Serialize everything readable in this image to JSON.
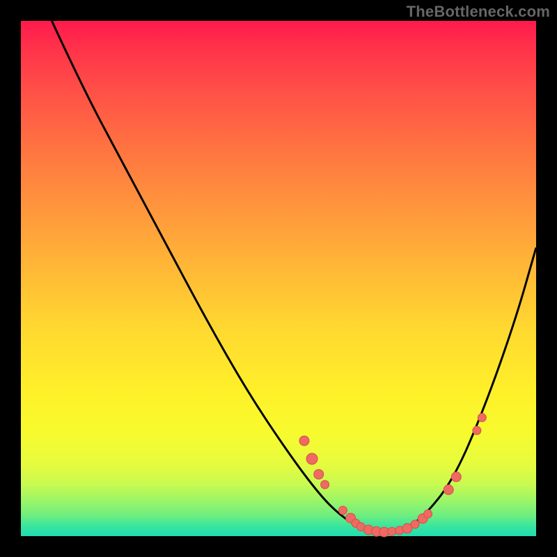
{
  "watermark": "TheBottleneck.com",
  "colors": {
    "frame": "#000000",
    "curve": "#000000",
    "dot_fill": "#ee6a62",
    "dot_stroke": "#d84f48"
  },
  "chart_data": {
    "type": "line",
    "title": "",
    "xlabel": "",
    "ylabel": "",
    "xlim": [
      0,
      100
    ],
    "ylim": [
      0,
      100
    ],
    "grid": false,
    "legend": false,
    "curve_points": [
      {
        "x": 6,
        "y": 100
      },
      {
        "x": 12,
        "y": 87
      },
      {
        "x": 20,
        "y": 72
      },
      {
        "x": 28,
        "y": 57
      },
      {
        "x": 36,
        "y": 42
      },
      {
        "x": 44,
        "y": 28
      },
      {
        "x": 52,
        "y": 16
      },
      {
        "x": 58,
        "y": 8
      },
      {
        "x": 62,
        "y": 4
      },
      {
        "x": 66,
        "y": 1.5
      },
      {
        "x": 70,
        "y": 0.8
      },
      {
        "x": 74,
        "y": 1.2
      },
      {
        "x": 78,
        "y": 3.5
      },
      {
        "x": 84,
        "y": 11
      },
      {
        "x": 90,
        "y": 25
      },
      {
        "x": 96,
        "y": 42
      },
      {
        "x": 100,
        "y": 56
      }
    ],
    "dot_clusters": [
      {
        "x": 55.0,
        "y": 18.5,
        "r": 7
      },
      {
        "x": 56.5,
        "y": 15.0,
        "r": 8
      },
      {
        "x": 57.8,
        "y": 12.0,
        "r": 7
      },
      {
        "x": 59.0,
        "y": 10.0,
        "r": 6
      },
      {
        "x": 62.5,
        "y": 5.0,
        "r": 6
      },
      {
        "x": 64.0,
        "y": 3.5,
        "r": 7
      },
      {
        "x": 65.0,
        "y": 2.5,
        "r": 6
      },
      {
        "x": 66.0,
        "y": 1.8,
        "r": 6
      },
      {
        "x": 67.5,
        "y": 1.2,
        "r": 7
      },
      {
        "x": 69.0,
        "y": 0.9,
        "r": 7
      },
      {
        "x": 70.5,
        "y": 0.8,
        "r": 7
      },
      {
        "x": 72.0,
        "y": 0.9,
        "r": 6
      },
      {
        "x": 73.5,
        "y": 1.1,
        "r": 6
      },
      {
        "x": 75.0,
        "y": 1.5,
        "r": 7
      },
      {
        "x": 76.5,
        "y": 2.3,
        "r": 6
      },
      {
        "x": 78.0,
        "y": 3.4,
        "r": 7
      },
      {
        "x": 79.0,
        "y": 4.3,
        "r": 6
      },
      {
        "x": 83.0,
        "y": 9.0,
        "r": 7
      },
      {
        "x": 84.5,
        "y": 11.5,
        "r": 7
      },
      {
        "x": 88.5,
        "y": 20.5,
        "r": 6
      },
      {
        "x": 89.5,
        "y": 23.0,
        "r": 6
      }
    ]
  }
}
